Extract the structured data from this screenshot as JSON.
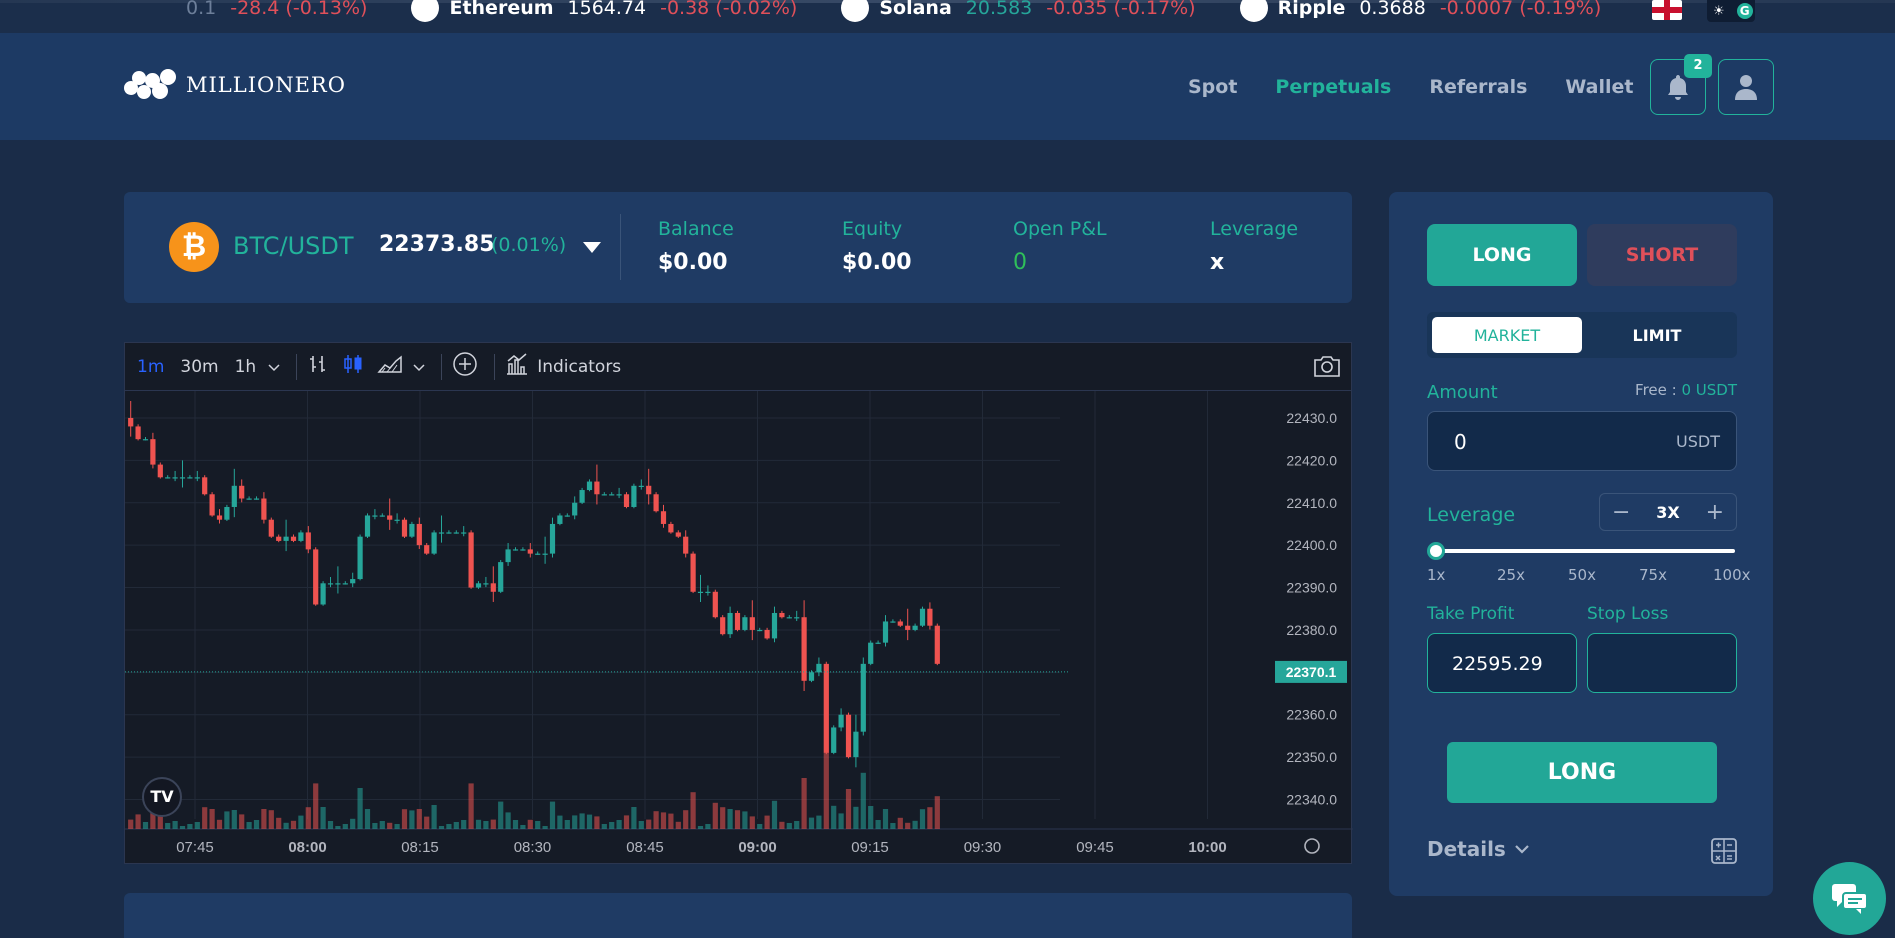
{
  "ticker": [
    {
      "name": "",
      "price": "0.1",
      "change": "-28.4 (-0.13%)",
      "up": false,
      "icon": "bitcoin-icon"
    },
    {
      "name": "Ethereum",
      "price": "1564.74",
      "change": "-0.38 (-0.02%)",
      "up": false,
      "icon": "ethereum-icon"
    },
    {
      "name": "Solana",
      "price": "20.583",
      "change": "-0.035 (-0.17%)",
      "up": true,
      "icon": "solana-icon"
    },
    {
      "name": "Ripple",
      "price": "0.3688",
      "change": "-0.0007 (-0.19%)",
      "up": false,
      "icon": "ripple-icon"
    }
  ],
  "header": {
    "logo_text": "MILLIONERO",
    "nav": [
      {
        "label": "Spot",
        "active": false
      },
      {
        "label": "Perpetuals",
        "active": true
      },
      {
        "label": "Referrals",
        "active": false
      },
      {
        "label": "Wallet",
        "active": false
      }
    ],
    "notification_count": "2",
    "theme_letter": "G"
  },
  "pair": {
    "symbol": "BTC/USDT",
    "price": "22373.85",
    "change": "(0.01%)",
    "coin_glyph": "₿",
    "stats": [
      {
        "label": "Balance",
        "value": "$0.00"
      },
      {
        "label": "Equity",
        "value": "$0.00"
      },
      {
        "label": "Open P&L",
        "value": "0"
      },
      {
        "label": "Leverage",
        "value": "x"
      }
    ]
  },
  "chart_toolbar": {
    "intervals": [
      "1m",
      "30m",
      "1h"
    ],
    "active_interval": "1m",
    "indicators_label": "Indicators"
  },
  "chart_data": {
    "type": "candlestick",
    "y_ticks": [
      "22430.0",
      "22420.0",
      "22410.0",
      "22400.0",
      "22390.0",
      "22380.0",
      "22370.0",
      "22360.0",
      "22350.0",
      "22340.0"
    ],
    "x_ticks": [
      {
        "label": "07:45",
        "bold": false
      },
      {
        "label": "08:00",
        "bold": true
      },
      {
        "label": "08:15",
        "bold": false
      },
      {
        "label": "08:30",
        "bold": false
      },
      {
        "label": "08:45",
        "bold": false
      },
      {
        "label": "09:00",
        "bold": true
      },
      {
        "label": "09:15",
        "bold": false
      },
      {
        "label": "09:30",
        "bold": false
      },
      {
        "label": "09:45",
        "bold": false
      },
      {
        "label": "10:00",
        "bold": true
      }
    ],
    "ylim": [
      22338,
      22434
    ],
    "last_price": "22370.1",
    "last_price_value": 22370.1,
    "up_color": "#26a69a",
    "down_color": "#ef5350",
    "closes": [
      22428,
      22425,
      22425,
      22419,
      22416,
      22416,
      22416,
      22416,
      22416,
      22416,
      22412,
      22407,
      22406,
      22409,
      22414,
      22411,
      22411,
      22411,
      22406,
      22402,
      22401,
      22402,
      22401,
      22403,
      22399,
      22386,
      22391,
      22391,
      22391,
      22391,
      22392,
      22402,
      22407,
      22407,
      22407,
      22406,
      22406,
      22402,
      22405,
      22400,
      22398,
      22403,
      22403,
      22403,
      22403,
      22403,
      22390,
      22391,
      22391,
      22389,
      22396,
      22399,
      22399,
      22399,
      22398,
      22398,
      22398,
      22405,
      22407,
      22407,
      22410,
      22413,
      22415,
      22412,
      22412,
      22412,
      22412,
      22409,
      22414,
      22414,
      22412,
      22408,
      22405,
      22403,
      22402,
      22398,
      22389,
      22389,
      22389,
      22383,
      22379,
      22384,
      22380,
      22383,
      22380,
      22380,
      22378,
      22384,
      22383,
      22383,
      22383,
      22368,
      22370,
      22372,
      22351,
      22357,
      22360,
      22350,
      22356,
      22372,
      22377,
      22377,
      22382,
      22382,
      22381,
      22380,
      22381,
      22385,
      22381,
      22372
    ]
  },
  "order": {
    "long_label": "LONG",
    "short_label": "SHORT",
    "market_label": "MARKET",
    "limit_label": "LIMIT",
    "amount_label": "Amount",
    "free_label": "Free : ",
    "free_value": "0 USDT",
    "amount_value": "0",
    "amount_unit": "USDT",
    "leverage_label": "Leverage",
    "leverage_value": "3X",
    "leverage_level": 0,
    "slider_ticks": [
      "1x",
      "25x",
      "50x",
      "75x",
      "100x"
    ],
    "take_profit_label": "Take Profit",
    "stop_loss_label": "Stop Loss",
    "take_profit_value": "22595.29",
    "stop_loss_value": "",
    "submit_label": "LONG",
    "details_label": "Details"
  }
}
